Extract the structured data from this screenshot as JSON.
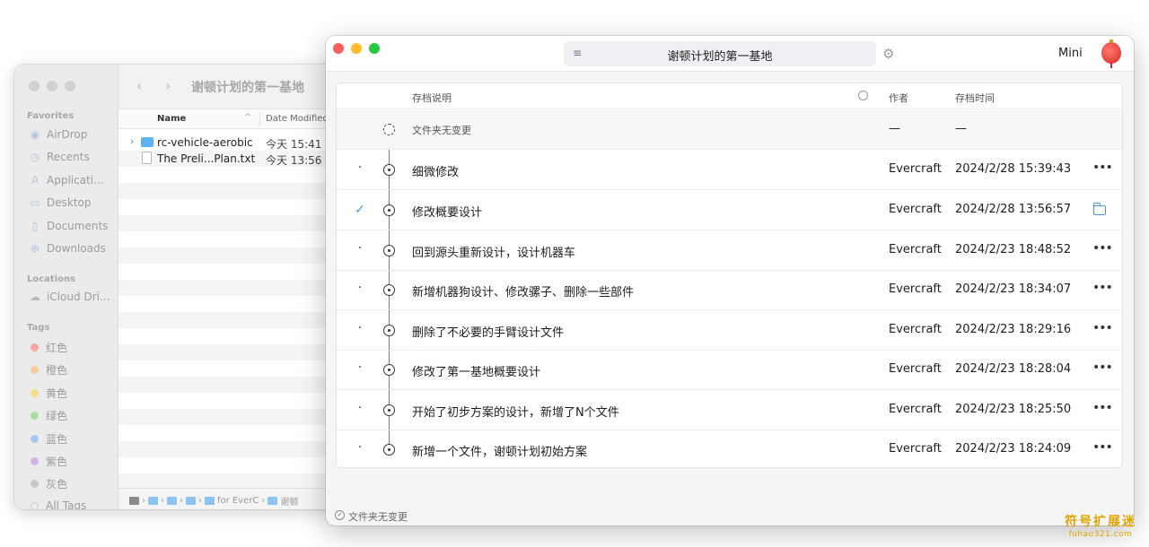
{
  "finder": {
    "title": "谢顿计划的第一基地",
    "sidebar": {
      "favorites_header": "Favorites",
      "favorites": [
        {
          "label": "AirDrop",
          "icon": "airdrop-icon"
        },
        {
          "label": "Recents",
          "icon": "clock-icon"
        },
        {
          "label": "Applicati...",
          "icon": "applications-icon"
        },
        {
          "label": "Desktop",
          "icon": "desktop-icon"
        },
        {
          "label": "Documents",
          "icon": "document-icon"
        },
        {
          "label": "Downloads",
          "icon": "download-icon"
        }
      ],
      "locations_header": "Locations",
      "locations": [
        {
          "label": "iCloud Dri...",
          "icon": "cloud-icon"
        }
      ],
      "tags_header": "Tags",
      "tags": [
        {
          "label": "红色",
          "color": "#f6a5a2"
        },
        {
          "label": "橙色",
          "color": "#f8c99a"
        },
        {
          "label": "黄色",
          "color": "#f5de8c"
        },
        {
          "label": "绿色",
          "color": "#a9dfa0"
        },
        {
          "label": "蓝色",
          "color": "#a4c8f2"
        },
        {
          "label": "紫色",
          "color": "#d4b1e8"
        },
        {
          "label": "灰色",
          "color": "#c8c8c8"
        },
        {
          "label": "All Tags",
          "color": ""
        }
      ]
    },
    "columns": {
      "name": "Name",
      "date": "Date Modified"
    },
    "files": [
      {
        "name": "rc-vehicle-aerobic",
        "date": "今天 15:41",
        "kind": "folder"
      },
      {
        "name": "The Preli...Plan.txt",
        "date": "今天 13:56",
        "kind": "file"
      }
    ],
    "pathbar": {
      "for_label": "for EverC",
      "last_label": "谢顿"
    }
  },
  "evercraft": {
    "title": "谢顿计划的第一基地",
    "mode_label": "Mini",
    "columns": {
      "description": "存档说明",
      "author": "作者",
      "time": "存档时间"
    },
    "pending_row": {
      "description": "文件夹无变更",
      "author": "—",
      "time": "—"
    },
    "commits": [
      {
        "description": "细微修改",
        "author": "Evercraft",
        "time": "2024/2/28 15:39:43",
        "current": false,
        "action": "more-icon"
      },
      {
        "description": "修改概要设计",
        "author": "Evercraft",
        "time": "2024/2/28 13:56:57",
        "current": true,
        "action": "folder-icon"
      },
      {
        "description": "回到源头重新设计，设计机器车",
        "author": "Evercraft",
        "time": "2024/2/23 18:48:52",
        "current": false,
        "action": "more-icon"
      },
      {
        "description": "新增机器狗设计、修改骡子、删除一些部件",
        "author": "Evercraft",
        "time": "2024/2/23 18:34:07",
        "current": false,
        "action": "more-icon"
      },
      {
        "description": "删除了不必要的手臂设计文件",
        "author": "Evercraft",
        "time": "2024/2/23 18:29:16",
        "current": false,
        "action": "more-icon"
      },
      {
        "description": "修改了第一基地概要设计",
        "author": "Evercraft",
        "time": "2024/2/23 18:28:04",
        "current": false,
        "action": "more-icon"
      },
      {
        "description": "开始了初步方案的设计，新增了N个文件",
        "author": "Evercraft",
        "time": "2024/2/23 18:25:50",
        "current": false,
        "action": "more-icon"
      },
      {
        "description": "新增一个文件，谢顿计划初始方案",
        "author": "Evercraft",
        "time": "2024/2/23 18:24:09",
        "current": false,
        "action": "more-icon"
      }
    ],
    "status": "文件夹无变更"
  },
  "watermark": {
    "cn": "符号扩展迷",
    "en": "fuhao321.com"
  },
  "colors": {
    "accent": "#4a90d9",
    "close": "#fe5f57",
    "minimize": "#febc2e",
    "zoom": "#28c840"
  }
}
